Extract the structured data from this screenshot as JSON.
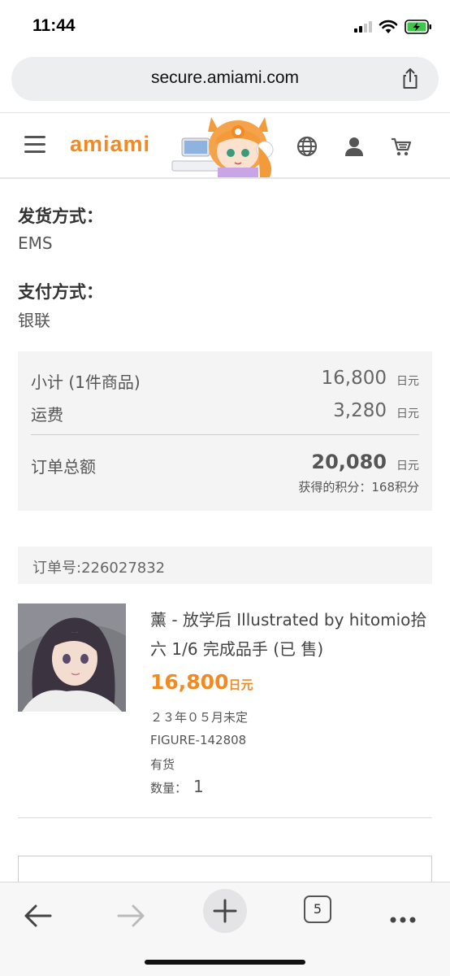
{
  "status": {
    "time": "11:44"
  },
  "browser": {
    "url": "secure.amiami.com",
    "tab_count": "5"
  },
  "header": {
    "logo": "amiami"
  },
  "shipping": {
    "label": "发货方式：",
    "value": "EMS"
  },
  "payment": {
    "label": "支付方式：",
    "value": "银联"
  },
  "summary": {
    "subtotal_label": "小计 (1件商品)",
    "subtotal_amount": "16,800",
    "shipping_label": "运费",
    "shipping_amount": "3,280",
    "total_label": "订单总额",
    "total_amount": "20,080",
    "unit": "日元",
    "points": "获得的积分：168积分"
  },
  "order": {
    "number": "订单号:226027832",
    "item": {
      "title": "薰 - 放学后 Illustrated by hitomio拾六 1/6 完成品手 (已 售)",
      "price": "16,800",
      "price_unit": "日元",
      "release": "２３年０５月未定",
      "code": "FIGURE-142808",
      "stock": "有货",
      "qty_label": "数量：",
      "qty": "1"
    }
  },
  "colors": {
    "accent": "#f08a24",
    "summary_bg": "#f4f4f4"
  },
  "icons": [
    "share-icon",
    "hamburger-icon",
    "globe-icon",
    "user-icon",
    "cart-icon",
    "back-icon",
    "forward-icon",
    "plus-icon",
    "more-icon"
  ]
}
